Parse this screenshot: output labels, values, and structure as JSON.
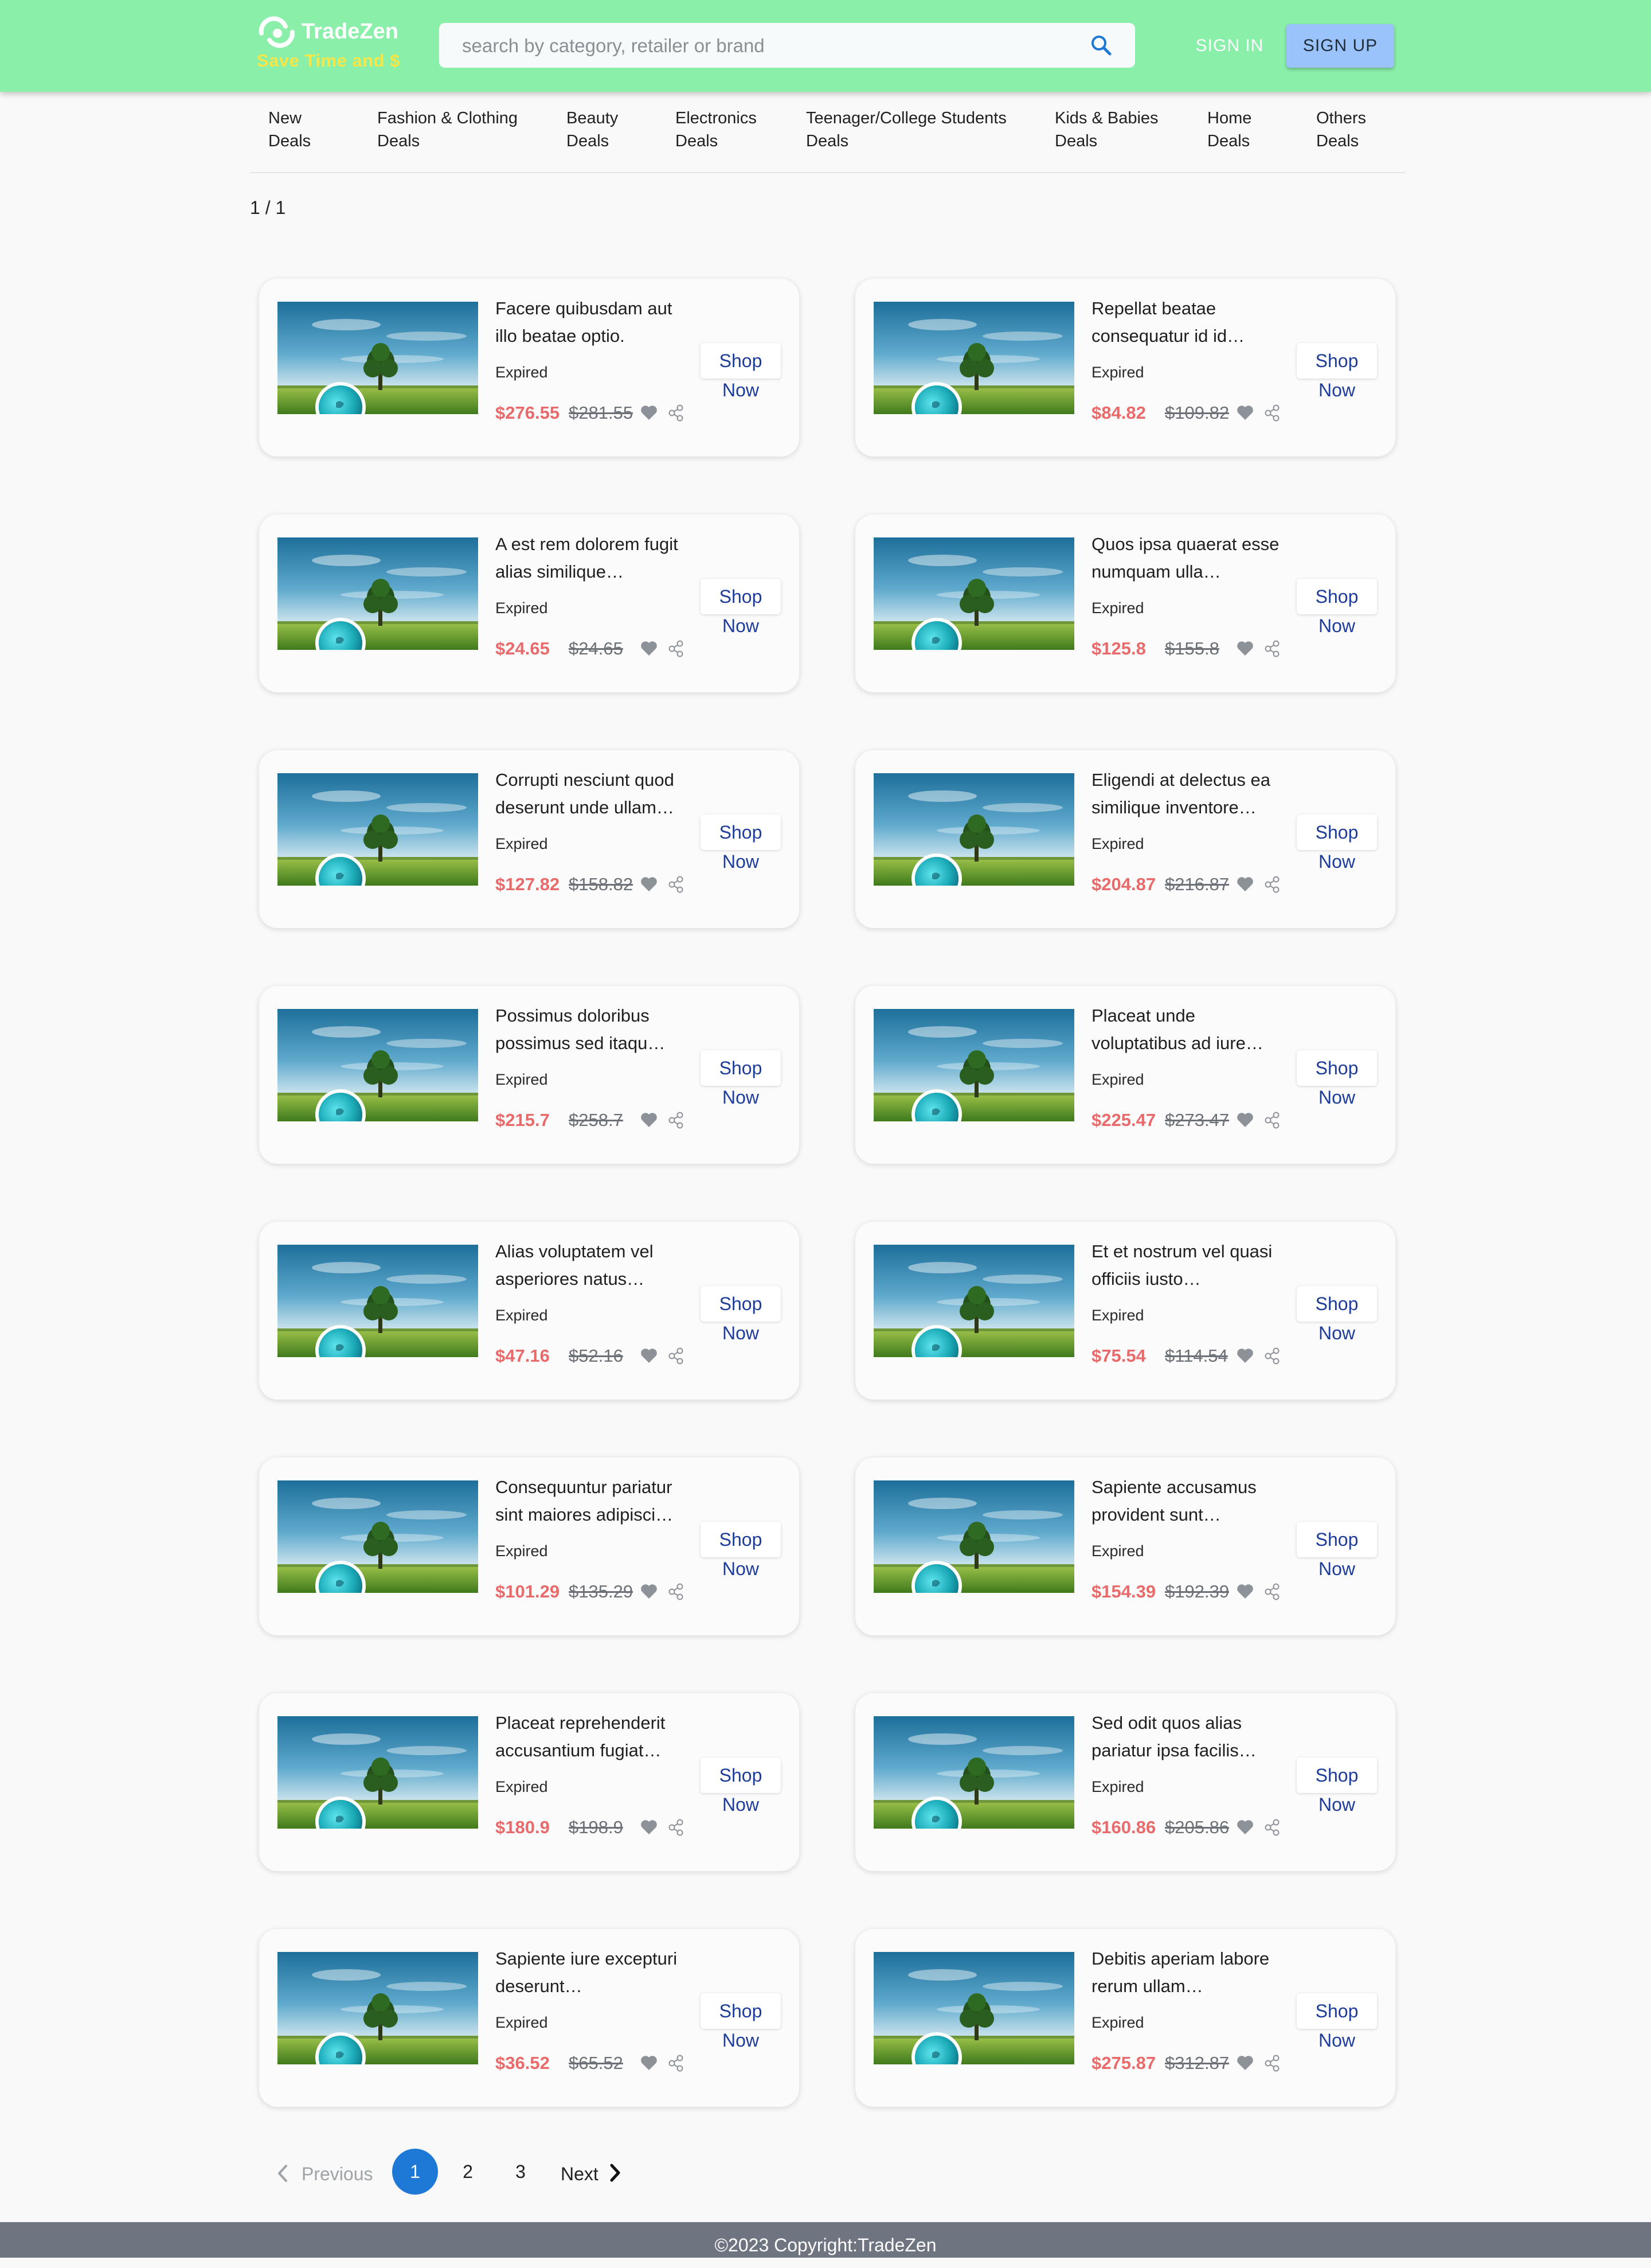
{
  "header": {
    "brand_name": "TradeZen",
    "tagline": "Save Time and $",
    "search_placeholder": "search by category, retailer or brand",
    "sign_in": "SIGN IN",
    "sign_up": "SIGN UP",
    "background_color": "#89efa9",
    "tagline_color": "#f5e64a"
  },
  "nav": {
    "items": [
      {
        "label": "New\nDeals"
      },
      {
        "label": "Fashion & Clothing\nDeals"
      },
      {
        "label": "Beauty\nDeals"
      },
      {
        "label": "Electronics\nDeals"
      },
      {
        "label": "Teenager/College Students\nDeals"
      },
      {
        "label": "Kids & Babies\nDeals"
      },
      {
        "label": "Home\nDeals"
      },
      {
        "label": "Others\nDeals"
      }
    ]
  },
  "page_indicator": "1 / 1",
  "deals": [
    {
      "title": "Facere quibusdam aut illo beatae optio.",
      "status": "Expired",
      "price": "$276.55",
      "original_price": "$281.55",
      "button_line1": "Shop",
      "button_line2": "Now"
    },
    {
      "title": "Repellat beatae consequatur id id…",
      "status": "Expired",
      "price": "$84.82",
      "original_price": "$109.82",
      "button_line1": "Shop",
      "button_line2": "Now"
    },
    {
      "title": "A est rem dolorem fugit alias similique…",
      "status": "Expired",
      "price": "$24.65",
      "original_price": "$24.65",
      "button_line1": "Shop",
      "button_line2": "Now"
    },
    {
      "title": "Quos ipsa quaerat esse numquam ulla…",
      "status": "Expired",
      "price": "$125.8",
      "original_price": "$155.8",
      "button_line1": "Shop",
      "button_line2": "Now"
    },
    {
      "title": "Corrupti nesciunt quod deserunt unde ullam…",
      "status": "Expired",
      "price": "$127.82",
      "original_price": "$158.82",
      "button_line1": "Shop",
      "button_line2": "Now"
    },
    {
      "title": "Eligendi at delectus ea similique inventore…",
      "status": "Expired",
      "price": "$204.87",
      "original_price": "$216.87",
      "button_line1": "Shop",
      "button_line2": "Now"
    },
    {
      "title": "Possimus doloribus possimus sed itaqu…",
      "status": "Expired",
      "price": "$215.7",
      "original_price": "$258.7",
      "button_line1": "Shop",
      "button_line2": "Now"
    },
    {
      "title": "Placeat unde voluptatibus ad iure…",
      "status": "Expired",
      "price": "$225.47",
      "original_price": "$273.47",
      "button_line1": "Shop",
      "button_line2": "Now"
    },
    {
      "title": "Alias voluptatem vel asperiores natus…",
      "status": "Expired",
      "price": "$47.16",
      "original_price": "$52.16",
      "button_line1": "Shop",
      "button_line2": "Now"
    },
    {
      "title": "Et et nostrum vel quasi officiis iusto…",
      "status": "Expired",
      "price": "$75.54",
      "original_price": "$114.54",
      "button_line1": "Shop",
      "button_line2": "Now"
    },
    {
      "title": "Consequuntur pariatur sint maiores adipisci…",
      "status": "Expired",
      "price": "$101.29",
      "original_price": "$135.29",
      "button_line1": "Shop",
      "button_line2": "Now"
    },
    {
      "title": "Sapiente accusamus provident sunt…",
      "status": "Expired",
      "price": "$154.39",
      "original_price": "$192.39",
      "button_line1": "Shop",
      "button_line2": "Now"
    },
    {
      "title": "Placeat reprehenderit accusantium fugiat…",
      "status": "Expired",
      "price": "$180.9",
      "original_price": "$198.9",
      "button_line1": "Shop",
      "button_line2": "Now"
    },
    {
      "title": "Sed odit quos alias pariatur ipsa facilis…",
      "status": "Expired",
      "price": "$160.86",
      "original_price": "$205.86",
      "button_line1": "Shop",
      "button_line2": "Now"
    },
    {
      "title": "Sapiente iure excepturi deserunt…",
      "status": "Expired",
      "price": "$36.52",
      "original_price": "$65.52",
      "button_line1": "Shop",
      "button_line2": "Now"
    },
    {
      "title": "Debitis aperiam labore rerum ullam…",
      "status": "Expired",
      "price": "$275.87",
      "original_price": "$312.87",
      "button_line1": "Shop",
      "button_line2": "Now"
    }
  ],
  "pagination": {
    "previous": "Previous",
    "next": "Next",
    "pages": [
      "1",
      "2",
      "3"
    ],
    "current": "1"
  },
  "footer": {
    "copyright": "©2023 Copyright:TradeZen"
  },
  "colors": {
    "price": "#e96a6a",
    "shop_button_text": "#1e3c9a",
    "active_page": "#1e78d6",
    "footer_bg": "#6e7581"
  }
}
